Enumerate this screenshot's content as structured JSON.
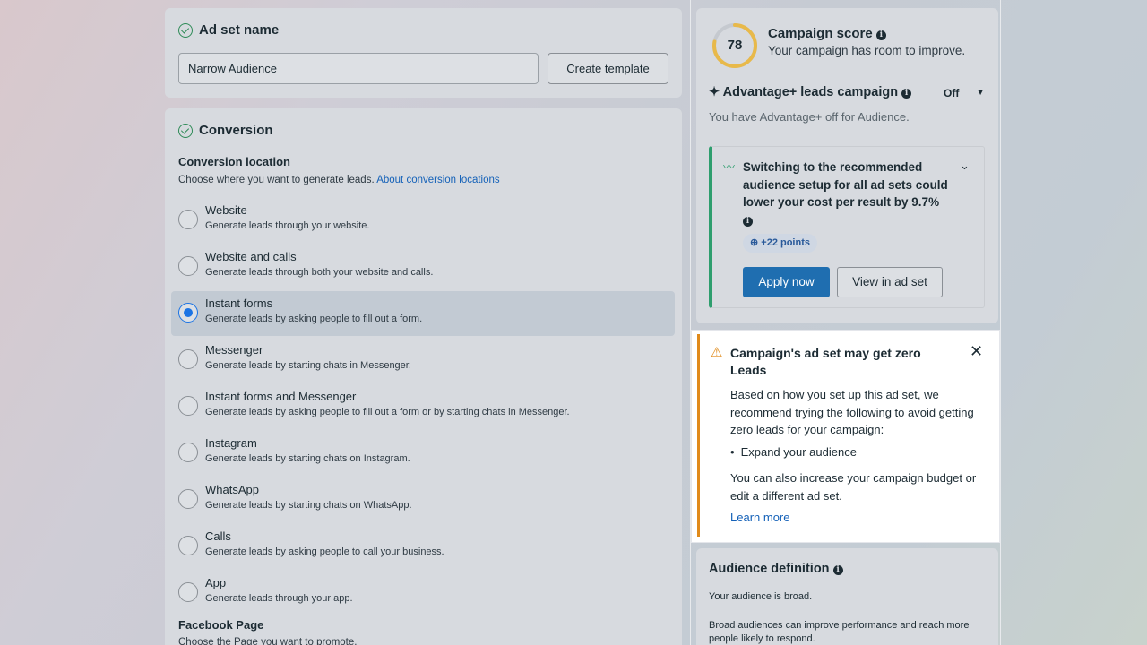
{
  "ad_set_name": {
    "title": "Ad set name",
    "input_value": "Narrow Audience",
    "create_template_label": "Create template"
  },
  "conversion": {
    "title": "Conversion",
    "location_title": "Conversion location",
    "location_desc": "Choose where you want to generate leads.",
    "location_link": "About conversion locations",
    "options": [
      {
        "label": "Website",
        "desc": "Generate leads through your website."
      },
      {
        "label": "Website and calls",
        "desc": "Generate leads through both your website and calls."
      },
      {
        "label": "Instant forms",
        "desc": "Generate leads by asking people to fill out a form."
      },
      {
        "label": "Messenger",
        "desc": "Generate leads by starting chats in Messenger."
      },
      {
        "label": "Instant forms and Messenger",
        "desc": "Generate leads by asking people to fill out a form or by starting chats in Messenger."
      },
      {
        "label": "Instagram",
        "desc": "Generate leads by starting chats on Instagram."
      },
      {
        "label": "WhatsApp",
        "desc": "Generate leads by starting chats on WhatsApp."
      },
      {
        "label": "Calls",
        "desc": "Generate leads by asking people to call your business."
      },
      {
        "label": "App",
        "desc": "Generate leads through your app."
      }
    ],
    "selected_option": "Instant forms",
    "facebook_page_title": "Facebook Page",
    "facebook_page_desc": "Choose the Page you want to promote."
  },
  "campaign_score": {
    "score": "78",
    "score_fraction": 0.78,
    "title": "Campaign score",
    "subtitle": "Your campaign has room to improve."
  },
  "advantage": {
    "title": "Advantage+ leads campaign",
    "toggle_value": "Off",
    "desc": "You have Advantage+ off for Audience."
  },
  "recommendation": {
    "text": "Switching to the recommended audience setup for all ad sets could lower your cost per result by 9.7%",
    "points": "+22 points",
    "apply_label": "Apply now",
    "view_label": "View in ad set"
  },
  "alert": {
    "title": "Campaign's ad set may get zero Leads",
    "body": "Based on how you set up this ad set, we recommend trying the following to avoid getting zero leads for your campaign:",
    "bullet": "Expand your audience",
    "footer": "You can also increase your campaign budget or edit a different ad set.",
    "learn_more": "Learn more"
  },
  "audience_definition": {
    "title": "Audience definition",
    "line1": "Your audience is broad.",
    "line2": "Broad audiences can improve performance and reach more people likely to respond."
  },
  "colors": {
    "primary_button": "#1f6eb0",
    "score_ring": "#e8b94a",
    "alert_accent": "#e08a1a",
    "recommendation_accent": "#2e9e6e",
    "link": "#1461b8"
  }
}
